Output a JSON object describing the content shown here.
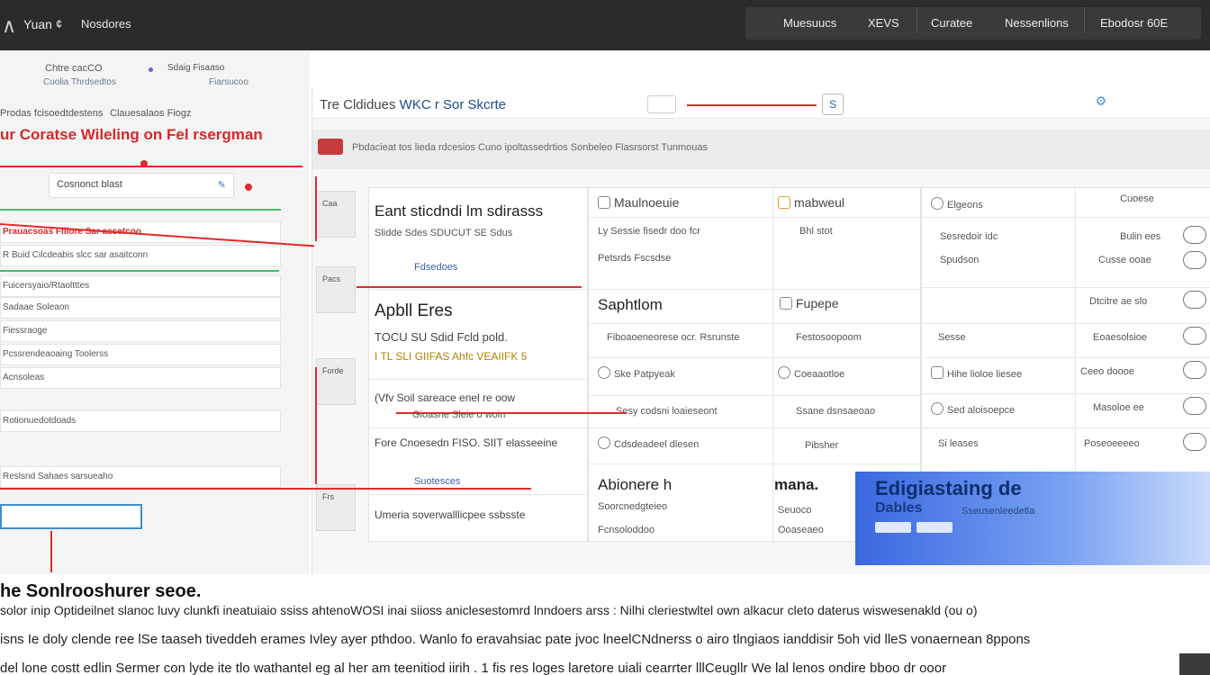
{
  "topbar": {
    "logo": "∧",
    "nav": [
      "Yuan",
      "¢",
      "Nosdores"
    ],
    "right_buttons": [
      "Muesuucs",
      "XEVS",
      "Curatee",
      "Nessenlions",
      "Ebodosr 60E"
    ]
  },
  "left": {
    "tabs": [
      {
        "label": "Chtre cacCO",
        "sub": "Cuolia Thrdsedtos"
      },
      {
        "label": "Sdaig Fisaaso",
        "sub": "Fiarsucoo"
      }
    ],
    "crumbs": [
      "Prodas fcisoedtdestens",
      "Clauesalaos Fiogz"
    ],
    "heading": "ur Coratse Wileling on Fel rsergman",
    "card": {
      "label": "Cosnonct blast",
      "edit": "✎"
    },
    "rows": [
      "Prauacsoas Fillore Sar acsetcoo",
      "R Buid Cilcdeabis slcc sar asaitconn",
      "Fuicersyaio/Rtaoltttes",
      "Sadaae Soleaon",
      "Fiessraoge",
      "Pcssrendeaoaing Toolerss",
      "Acnsoleas",
      "Rotionuedotdoads",
      "Reslsnd Sahaes sarsueaho"
    ],
    "input_value": ""
  },
  "main": {
    "title_prefix": "Tre Cldidues",
    "title_main": "WKC r Sor Skcrte",
    "search_glyph": "S",
    "sub_text": "Pbdacieat tos lieda rdcesios Cuno ipoltassedrtios Sonbeleo Flasrsorst Tunmouas",
    "thumbs": [
      "Caa",
      "Pacs",
      "Forde",
      "Frs"
    ],
    "colA": {
      "row1_title": "Eant sticdndi lm sdirasss",
      "row1_sub": "Slidde  Sdes SDUCUT SE Sdus",
      "row1_link": "Fdsedoes",
      "row2_title": "Apbll Eres",
      "row2_sub": "TOCU SU Sdid Fcld pold.",
      "row2_tags": "I TL SLI GIIFAS Ahfc VEAIIFK 5",
      "row3_title": "(Vfv Soil sareace enel re oow",
      "row3_sub": "Gioasne Sleie o woin",
      "row4_title": "Fore Cnoesedn FISO. SIIT elasseeine",
      "row5_link": "Suotesces",
      "row6_title": "Umeria soverwalllicpee ssbsste"
    },
    "colB": {
      "h1": "Maulnoeuie",
      "h2": "mabweul",
      "r1a": "Ly Sessie fisedr doo fcr",
      "r1b": "Bhl stot",
      "r1c": "Petsrds  Fscsdse",
      "sec": "Saphtlom",
      "sec2": "Fupepe",
      "r2a": "Fiboaoeneorese ocr. Rsrunste",
      "r2b": "Festosoopoom",
      "r3a": "Ske Patpyeak",
      "r3b": "Coeaaotloe",
      "r4a": "Sesy codsni loaieseont",
      "r4b": "Ssane dsnsaeoao",
      "r5a": "Cdsdeadeel dlesen",
      "r5b": "Pibsher",
      "r6a": "Abionere h",
      "r6b": "mana.",
      "r7a": "Soorcnedgteieo",
      "r7b": "Seuoco",
      "r8a": "Fcnsoloddoo",
      "r8b": "Ooaseaeo"
    },
    "colC": {
      "h": "Elgeons",
      "h_right": "Cuoese",
      "rows": [
        {
          "left": "Sesredoir idc",
          "right": "Bulin ees"
        },
        {
          "left": "Spudson",
          "right": "Cusse ooae"
        },
        {
          "left": "",
          "right": "Dtcitre ae slo"
        },
        {
          "left": "Sesse",
          "right": "Eoaesolsioe"
        },
        {
          "left": "Hihe lioloe liesee",
          "right": "Ceeo doooe"
        },
        {
          "left": "Sed aloisoepce",
          "right": "Masoloe ee"
        },
        {
          "left": "Si leases",
          "right": "Poseoeeeeo"
        }
      ]
    },
    "blue_panel": {
      "line1": "Edigiastaing de",
      "line2": "Dables",
      "line3": "Sseusenleedetla"
    }
  },
  "article": {
    "heading": "he Sonlrooshurer seoe.",
    "lines": [
      "solor  inip  Optideilnet slanoc luvy clunkfi ineatuiaio ssiss ahtenoWOSI inai siioss aniclesestomrd lnndoers arss : Nilhi cleriestwltel own alkacur cleto daterus wiswesenakld (ou o)",
      "isns Ie doly clende ree lSe taaseh tiveddeh erames Ivley ayer pthdoo. Wanlo fo eravahsiac pate jvoc lneelCNdnerss o airo tlngiaos ianddisir 5oh vid lleS vonaernean 8ppons",
      "del lone costt edlin Sermer con lyde ite tlo wathantel eg al her am teenitiod iirih . 1 fis res loges laretore uiali cearrter  lllCeugllr  We lal lenos ondire bboo dr ooor"
    ]
  }
}
